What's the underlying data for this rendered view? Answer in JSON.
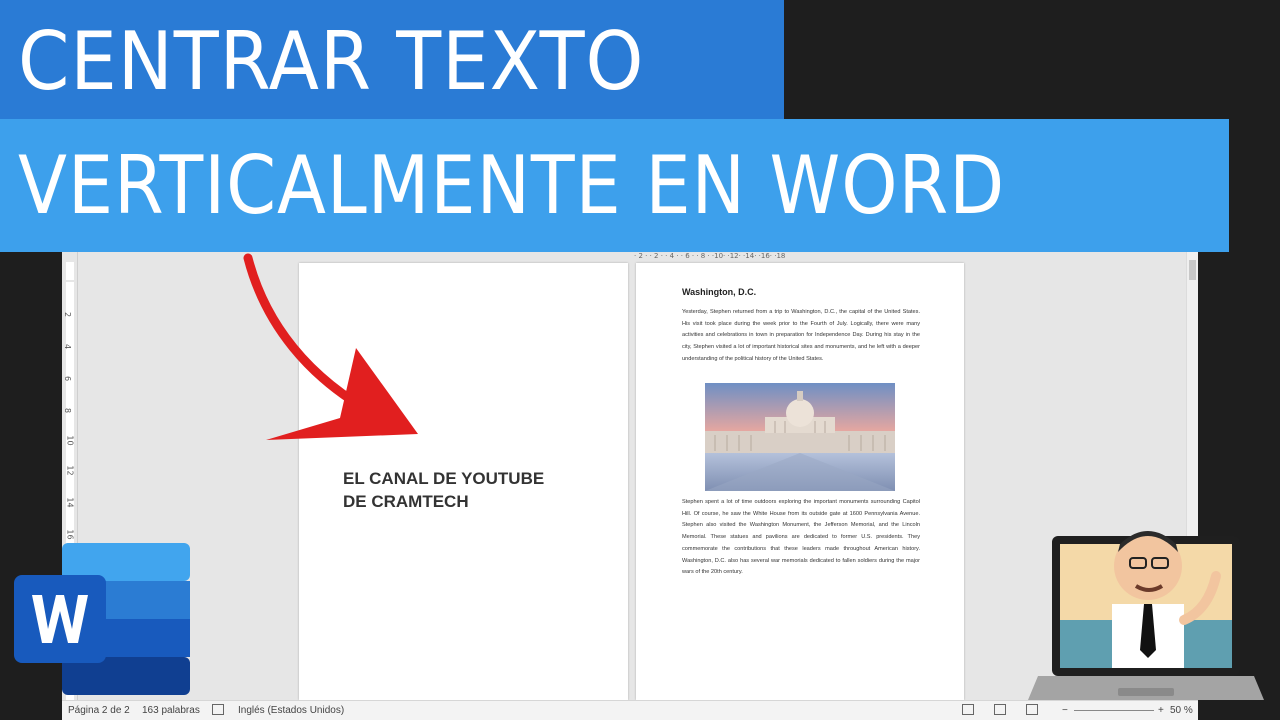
{
  "banner": {
    "line1": "CENTRAR TEXTO",
    "line2": "VERTICALMENTE EN WORD"
  },
  "colors": {
    "banner_dark": "#2a7bd5",
    "banner_light": "#3da0ec",
    "arrow": "#e11f1f",
    "word_blue": "#185abd"
  },
  "ruler": {
    "vertical_labels": [
      "2",
      "4",
      "6",
      "8",
      "10",
      "12",
      "14",
      "16"
    ],
    "horizontal_labels": "· 2 ·  · 2 ·  · 4 ·  · 6 ·  · 8 ·  ·10·  ·12·  ·14·  ·16·  ·18"
  },
  "document": {
    "page1": {
      "title": "EL CANAL DE YOUTUBE\nDE CRAMTECH"
    },
    "page2": {
      "heading": "Washington, D.C.",
      "paragraph1": "Yesterday, Stephen returned from a trip to Washington, D.C., the capital of the United States. His visit took place during the week prior to the Fourth of July. Logically, there were many activities and celebrations in town in preparation for Independence Day. During his stay in the city, Stephen visited a lot of important historical sites and monuments, and he left with a deeper understanding of the political history of the United States.",
      "paragraph2": "Stephen spent a lot of time outdoors exploring the important monuments surrounding Capitol Hill. Of course, he saw the White House from its outside gate at 1600 Pennsylvania Avenue. Stephen also visited the Washington Monument, the Jefferson Memorial, and the Lincoln Memorial. These statues and pavilions are dedicated to former U.S. presidents. They commemorate the contributions that these leaders made throughout American history. Washington, D.C. also has several war memorials dedicated to fallen soldiers during the major wars of the 20th century."
    }
  },
  "statusbar": {
    "page": "Página 2 de 2",
    "words": "163 palabras",
    "language": "Inglés (Estados Unidos)",
    "zoom": "50 %"
  },
  "icons": {
    "word_logo": "word-logo-icon",
    "arrow": "red-arrow-icon",
    "avatar": "cartoon-laptop-avatar"
  }
}
